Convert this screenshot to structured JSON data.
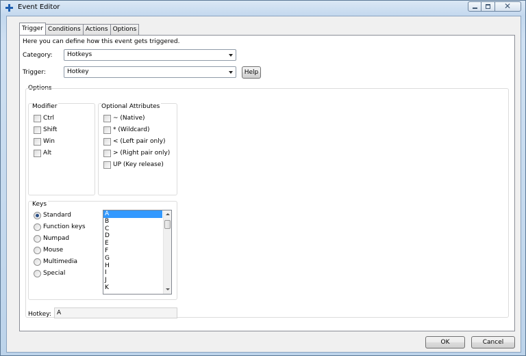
{
  "window": {
    "title": "Event Editor",
    "close_glyph": "✕"
  },
  "tabs": [
    {
      "label": "Trigger",
      "active": true
    },
    {
      "label": "Conditions",
      "active": false
    },
    {
      "label": "Actions",
      "active": false
    },
    {
      "label": "Options",
      "active": false
    }
  ],
  "trigger_page": {
    "intro": "Here you can define how this event gets triggered.",
    "category_label": "Category:",
    "category_value": "Hotkeys",
    "trigger_label": "Trigger:",
    "trigger_value": "Hotkey",
    "help_label": "Help",
    "options_label": "Options",
    "modifier": {
      "title": "Modifier",
      "items": [
        "Ctrl",
        "Shift",
        "Win",
        "Alt"
      ]
    },
    "optional_attributes": {
      "title": "Optional Attributes",
      "items": [
        "~ (Native)",
        "* (Wildcard)",
        "< (Left pair only)",
        "> (Right pair only)",
        "UP (Key release)"
      ]
    },
    "keys": {
      "title": "Keys",
      "radios": [
        "Standard",
        "Function keys",
        "Numpad",
        "Mouse",
        "Multimedia",
        "Special"
      ],
      "selected_radio": "Standard",
      "list": [
        "A",
        "B",
        "C",
        "D",
        "E",
        "F",
        "G",
        "H",
        "I",
        "J",
        "K"
      ],
      "selected_key": "A"
    },
    "hotkey_label": "Hotkey:",
    "hotkey_value": "A"
  },
  "footer": {
    "ok_label": "OK",
    "cancel_label": "Cancel"
  }
}
